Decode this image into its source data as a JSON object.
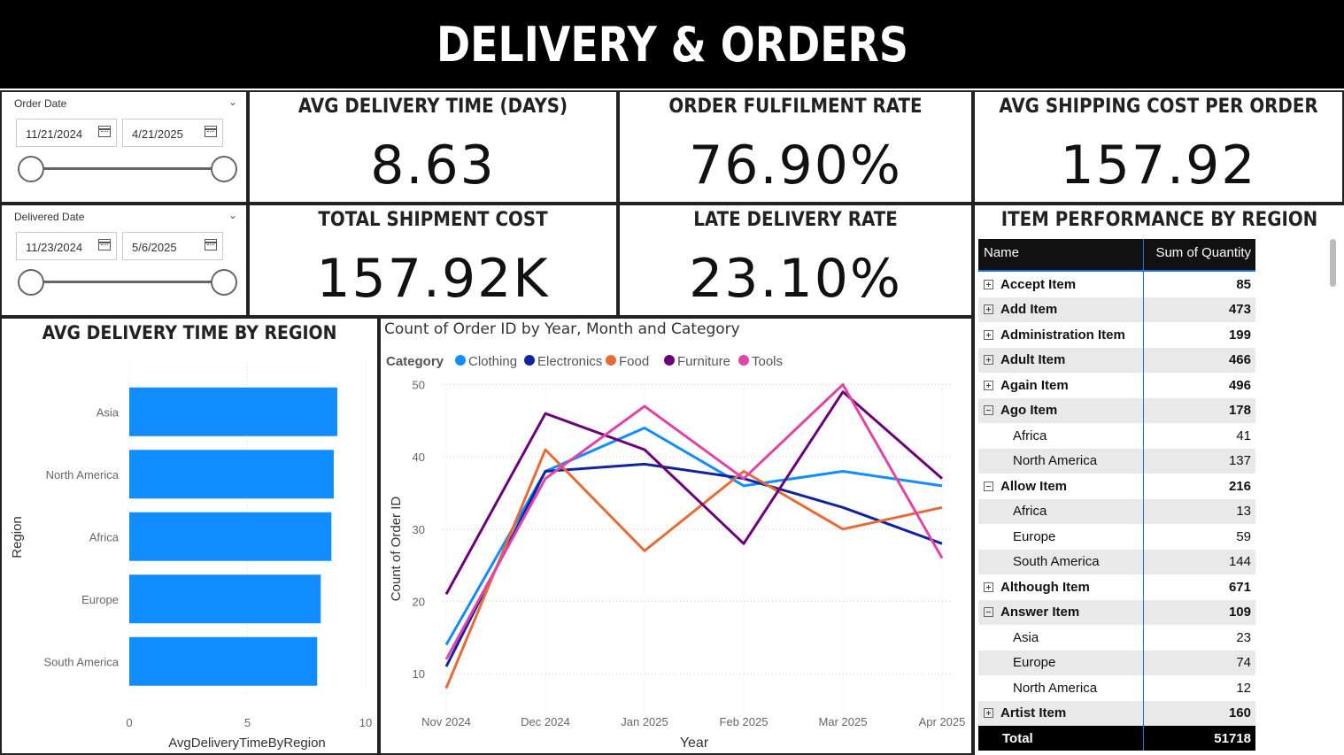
{
  "title": "DELIVERY & ORDERS",
  "slicers": [
    {
      "title": "Order Date",
      "start": "11/21/2024",
      "end": "4/21/2025"
    },
    {
      "title": "Delivered Date",
      "start": "11/23/2024",
      "end": "5/6/2025"
    }
  ],
  "kpis": {
    "avg_delivery": {
      "label": "AVG DELIVERY TIME (DAYS)",
      "value": "8.63"
    },
    "fulfilment": {
      "label": "ORDER FULFILMENT RATE",
      "value": "76.90%"
    },
    "shipping": {
      "label": "AVG SHIPPING COST PER ORDER",
      "value": "157.92"
    },
    "total_cost": {
      "label": "TOTAL SHIPMENT COST",
      "value": "157.92K"
    },
    "late_rate": {
      "label": "LATE DELIVERY RATE",
      "value": "23.10%"
    }
  },
  "colors": {
    "bar": "#118dff",
    "header_bg": "#000000"
  },
  "bar_chart": {
    "title": "AVG DELIVERY TIME BY REGION",
    "chart_data": {
      "type": "bar",
      "orientation": "horizontal",
      "categories": [
        "Asia",
        "North America",
        "Africa",
        "Europe",
        "South America"
      ],
      "values": [
        8.8,
        8.65,
        8.55,
        8.1,
        7.95
      ],
      "xlabel": "AvgDeliveryTimeByRegion",
      "ylabel": "Region",
      "xlim": [
        0,
        10
      ],
      "xticks": [
        "0",
        "5",
        "10"
      ]
    }
  },
  "line_chart": {
    "title": "Count of Order ID by Year, Month and Category",
    "legend_title": "Category",
    "chart_data": {
      "type": "line",
      "x": [
        "Nov 2024",
        "Dec 2024",
        "Jan 2025",
        "Feb 2025",
        "Mar 2025",
        "Apr 2025"
      ],
      "series": [
        {
          "name": "Clothing",
          "color": "#118dff",
          "values": [
            14,
            38,
            44,
            36,
            38,
            36
          ]
        },
        {
          "name": "Electronics",
          "color": "#12239e",
          "values": [
            11,
            38,
            39,
            37,
            33,
            28
          ]
        },
        {
          "name": "Food",
          "color": "#e66c37",
          "values": [
            8,
            41,
            27,
            38,
            30,
            33
          ]
        },
        {
          "name": "Furniture",
          "color": "#6b007b",
          "values": [
            21,
            46,
            41,
            28,
            49,
            37
          ]
        },
        {
          "name": "Tools",
          "color": "#e044a7",
          "values": [
            12,
            37,
            47,
            37,
            50,
            26
          ]
        }
      ],
      "xlabel": "Year",
      "ylabel": "Count of Order ID",
      "ylim": [
        5,
        50
      ],
      "yticks": [
        "10",
        "20",
        "30",
        "40",
        "50"
      ],
      "grid": true,
      "legend": "top-left"
    }
  },
  "matrix": {
    "title": "ITEM PERFORMANCE BY REGION",
    "headers": [
      "Name",
      "Sum of Quantity"
    ],
    "rows": [
      {
        "name": "Accept Item",
        "value": "85",
        "level": 0,
        "state": "collapsed"
      },
      {
        "name": "Add Item",
        "value": "473",
        "level": 0,
        "state": "collapsed"
      },
      {
        "name": "Administration Item",
        "value": "199",
        "level": 0,
        "state": "collapsed"
      },
      {
        "name": "Adult Item",
        "value": "466",
        "level": 0,
        "state": "collapsed"
      },
      {
        "name": "Again Item",
        "value": "496",
        "level": 0,
        "state": "collapsed"
      },
      {
        "name": "Ago Item",
        "value": "178",
        "level": 0,
        "state": "expanded"
      },
      {
        "name": "Africa",
        "value": "41",
        "level": 1
      },
      {
        "name": "North America",
        "value": "137",
        "level": 1
      },
      {
        "name": "Allow Item",
        "value": "216",
        "level": 0,
        "state": "expanded"
      },
      {
        "name": "Africa",
        "value": "13",
        "level": 1
      },
      {
        "name": "Europe",
        "value": "59",
        "level": 1
      },
      {
        "name": "South America",
        "value": "144",
        "level": 1
      },
      {
        "name": "Although Item",
        "value": "671",
        "level": 0,
        "state": "collapsed"
      },
      {
        "name": "Answer Item",
        "value": "109",
        "level": 0,
        "state": "expanded"
      },
      {
        "name": "Asia",
        "value": "23",
        "level": 1
      },
      {
        "name": "Europe",
        "value": "74",
        "level": 1
      },
      {
        "name": "North America",
        "value": "12",
        "level": 1
      },
      {
        "name": "Artist Item",
        "value": "160",
        "level": 0,
        "state": "collapsed"
      }
    ],
    "total": {
      "name": "Total",
      "value": "51718"
    }
  }
}
